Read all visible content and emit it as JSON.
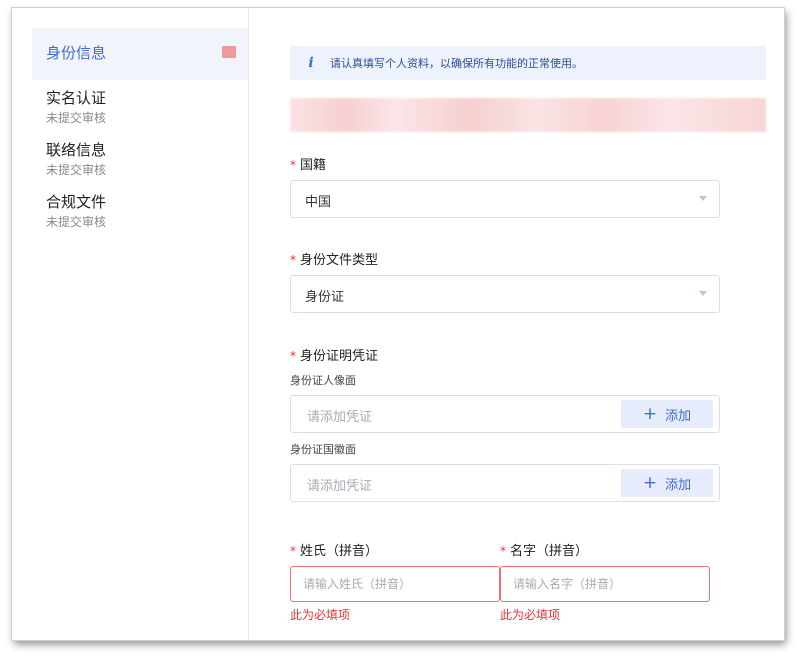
{
  "sidebar": {
    "active": {
      "label": "身份信息"
    },
    "items": [
      {
        "title": "实名认证",
        "status": "未提交审核"
      },
      {
        "title": "联络信息",
        "status": "未提交审核"
      },
      {
        "title": "合规文件",
        "status": "未提交审核"
      }
    ]
  },
  "notice": {
    "icon": "i",
    "text": "请认真填写个人资料，以确保所有功能的正常使用。"
  },
  "form": {
    "required_mark": "*",
    "nationality": {
      "label": "国籍",
      "value": "中国"
    },
    "doc_type": {
      "label": "身份文件类型",
      "value": "身份证"
    },
    "proof": {
      "label": "身份证明凭证",
      "front": {
        "label": "身份证人像面",
        "placeholder": "请添加凭证",
        "button": "添加",
        "button_icon": "+"
      },
      "back": {
        "label": "身份证国徽面",
        "placeholder": "请添加凭证",
        "button": "添加",
        "button_icon": "+"
      }
    },
    "surname": {
      "label": "姓氏（拼音）",
      "placeholder": "请输入姓氏（拼音）",
      "error": "此为必填项"
    },
    "given_name": {
      "label": "名字（拼音）",
      "placeholder": "请输入名字（拼音）",
      "error": "此为必填项"
    }
  },
  "colors": {
    "accent": "#3f6bd6",
    "error": "#e33333",
    "notice_bg": "#eef2fd"
  }
}
